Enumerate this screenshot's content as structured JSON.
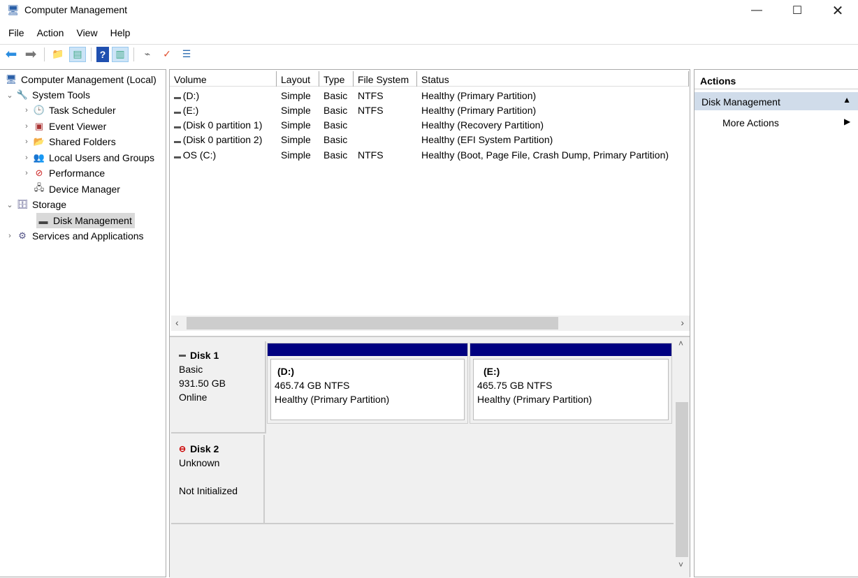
{
  "window": {
    "title": "Computer Management"
  },
  "menu": [
    "File",
    "Action",
    "View",
    "Help"
  ],
  "tree": {
    "root": "Computer Management (Local)",
    "system_tools": "System Tools",
    "system_children": [
      "Task Scheduler",
      "Event Viewer",
      "Shared Folders",
      "Local Users and Groups",
      "Performance",
      "Device Manager"
    ],
    "storage": "Storage",
    "disk_management": "Disk Management",
    "services": "Services and Applications"
  },
  "volumes": {
    "columns": [
      "Volume",
      "Layout",
      "Type",
      "File System",
      "Status"
    ],
    "rows": [
      [
        "(D:)",
        "Simple",
        "Basic",
        "NTFS",
        "Healthy (Primary Partition)"
      ],
      [
        "(E:)",
        "Simple",
        "Basic",
        "NTFS",
        "Healthy (Primary Partition)"
      ],
      [
        "(Disk 0 partition 1)",
        "Simple",
        "Basic",
        "",
        "Healthy (Recovery Partition)"
      ],
      [
        "(Disk 0 partition 2)",
        "Simple",
        "Basic",
        "",
        "Healthy (EFI System Partition)"
      ],
      [
        "OS (C:)",
        "Simple",
        "Basic",
        "NTFS",
        "Healthy (Boot, Page File, Crash Dump, Primary Partition)"
      ]
    ]
  },
  "disks": [
    {
      "name": "Disk 1",
      "type": "Basic",
      "size": "931.50 GB",
      "state": "Online",
      "partitions": [
        {
          "name": "(D:)",
          "size": "465.74 GB NTFS",
          "status": "Healthy (Primary Partition)"
        },
        {
          "name": "(E:)",
          "size": "465.75 GB NTFS",
          "status": "Healthy (Primary Partition)"
        }
      ]
    },
    {
      "name": "Disk 2",
      "type": "Unknown",
      "state": "Not Initialized"
    }
  ],
  "actions": {
    "header": "Actions",
    "section": "Disk Management",
    "item": "More Actions"
  },
  "colors": {
    "partition_bar": "#000080",
    "actions_section": "#d0dcea"
  }
}
